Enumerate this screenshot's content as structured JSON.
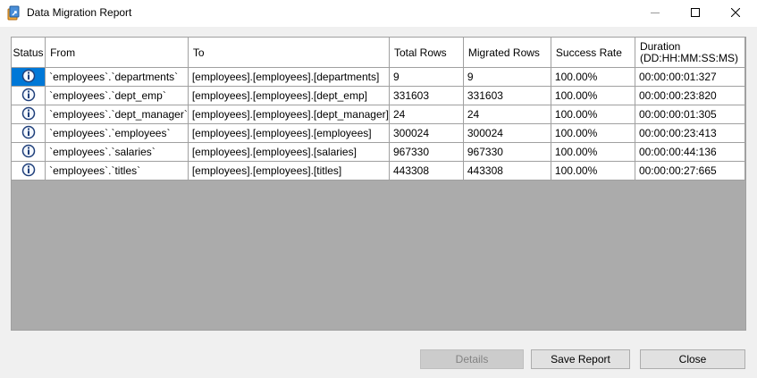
{
  "window": {
    "title": "Data Migration Report",
    "icon": "migration-app-icon",
    "controls": [
      "minimize",
      "maximize",
      "close"
    ]
  },
  "grid": {
    "columns": [
      {
        "label": "Status"
      },
      {
        "label": "From"
      },
      {
        "label": "To"
      },
      {
        "label": "Total Rows"
      },
      {
        "label": "Migrated Rows"
      },
      {
        "label": "Success Rate"
      },
      {
        "label": "Duration",
        "sublabel": "(DD:HH:MM:SS:MS)"
      }
    ],
    "rows": [
      {
        "status": "info-icon",
        "from": "`employees`.`departments`",
        "to": "[employees].[employees].[departments]",
        "total": "9",
        "migrated": "9",
        "rate": "100.00%",
        "duration": "00:00:00:01:327"
      },
      {
        "status": "info-icon",
        "from": "`employees`.`dept_emp`",
        "to": "[employees].[employees].[dept_emp]",
        "total": "331603",
        "migrated": "331603",
        "rate": "100.00%",
        "duration": "00:00:00:23:820"
      },
      {
        "status": "info-icon",
        "from": "`employees`.`dept_manager`",
        "to": "[employees].[employees].[dept_manager]",
        "total": "24",
        "migrated": "24",
        "rate": "100.00%",
        "duration": "00:00:00:01:305"
      },
      {
        "status": "info-icon",
        "from": "`employees`.`employees`",
        "to": "[employees].[employees].[employees]",
        "total": "300024",
        "migrated": "300024",
        "rate": "100.00%",
        "duration": "00:00:00:23:413"
      },
      {
        "status": "info-icon",
        "from": "`employees`.`salaries`",
        "to": "[employees].[employees].[salaries]",
        "total": "967330",
        "migrated": "967330",
        "rate": "100.00%",
        "duration": "00:00:00:44:136"
      },
      {
        "status": "info-icon",
        "from": "`employees`.`titles`",
        "to": "[employees].[employees].[titles]",
        "total": "443308",
        "migrated": "443308",
        "rate": "100.00%",
        "duration": "00:00:00:27:665"
      }
    ],
    "selected_row": 0
  },
  "buttons": {
    "details": "Details",
    "save_report": "Save Report",
    "close": "Close"
  },
  "colors": {
    "selection": "#0078d7",
    "grid_background": "#ababab",
    "window_background": "#f0f0f0"
  }
}
